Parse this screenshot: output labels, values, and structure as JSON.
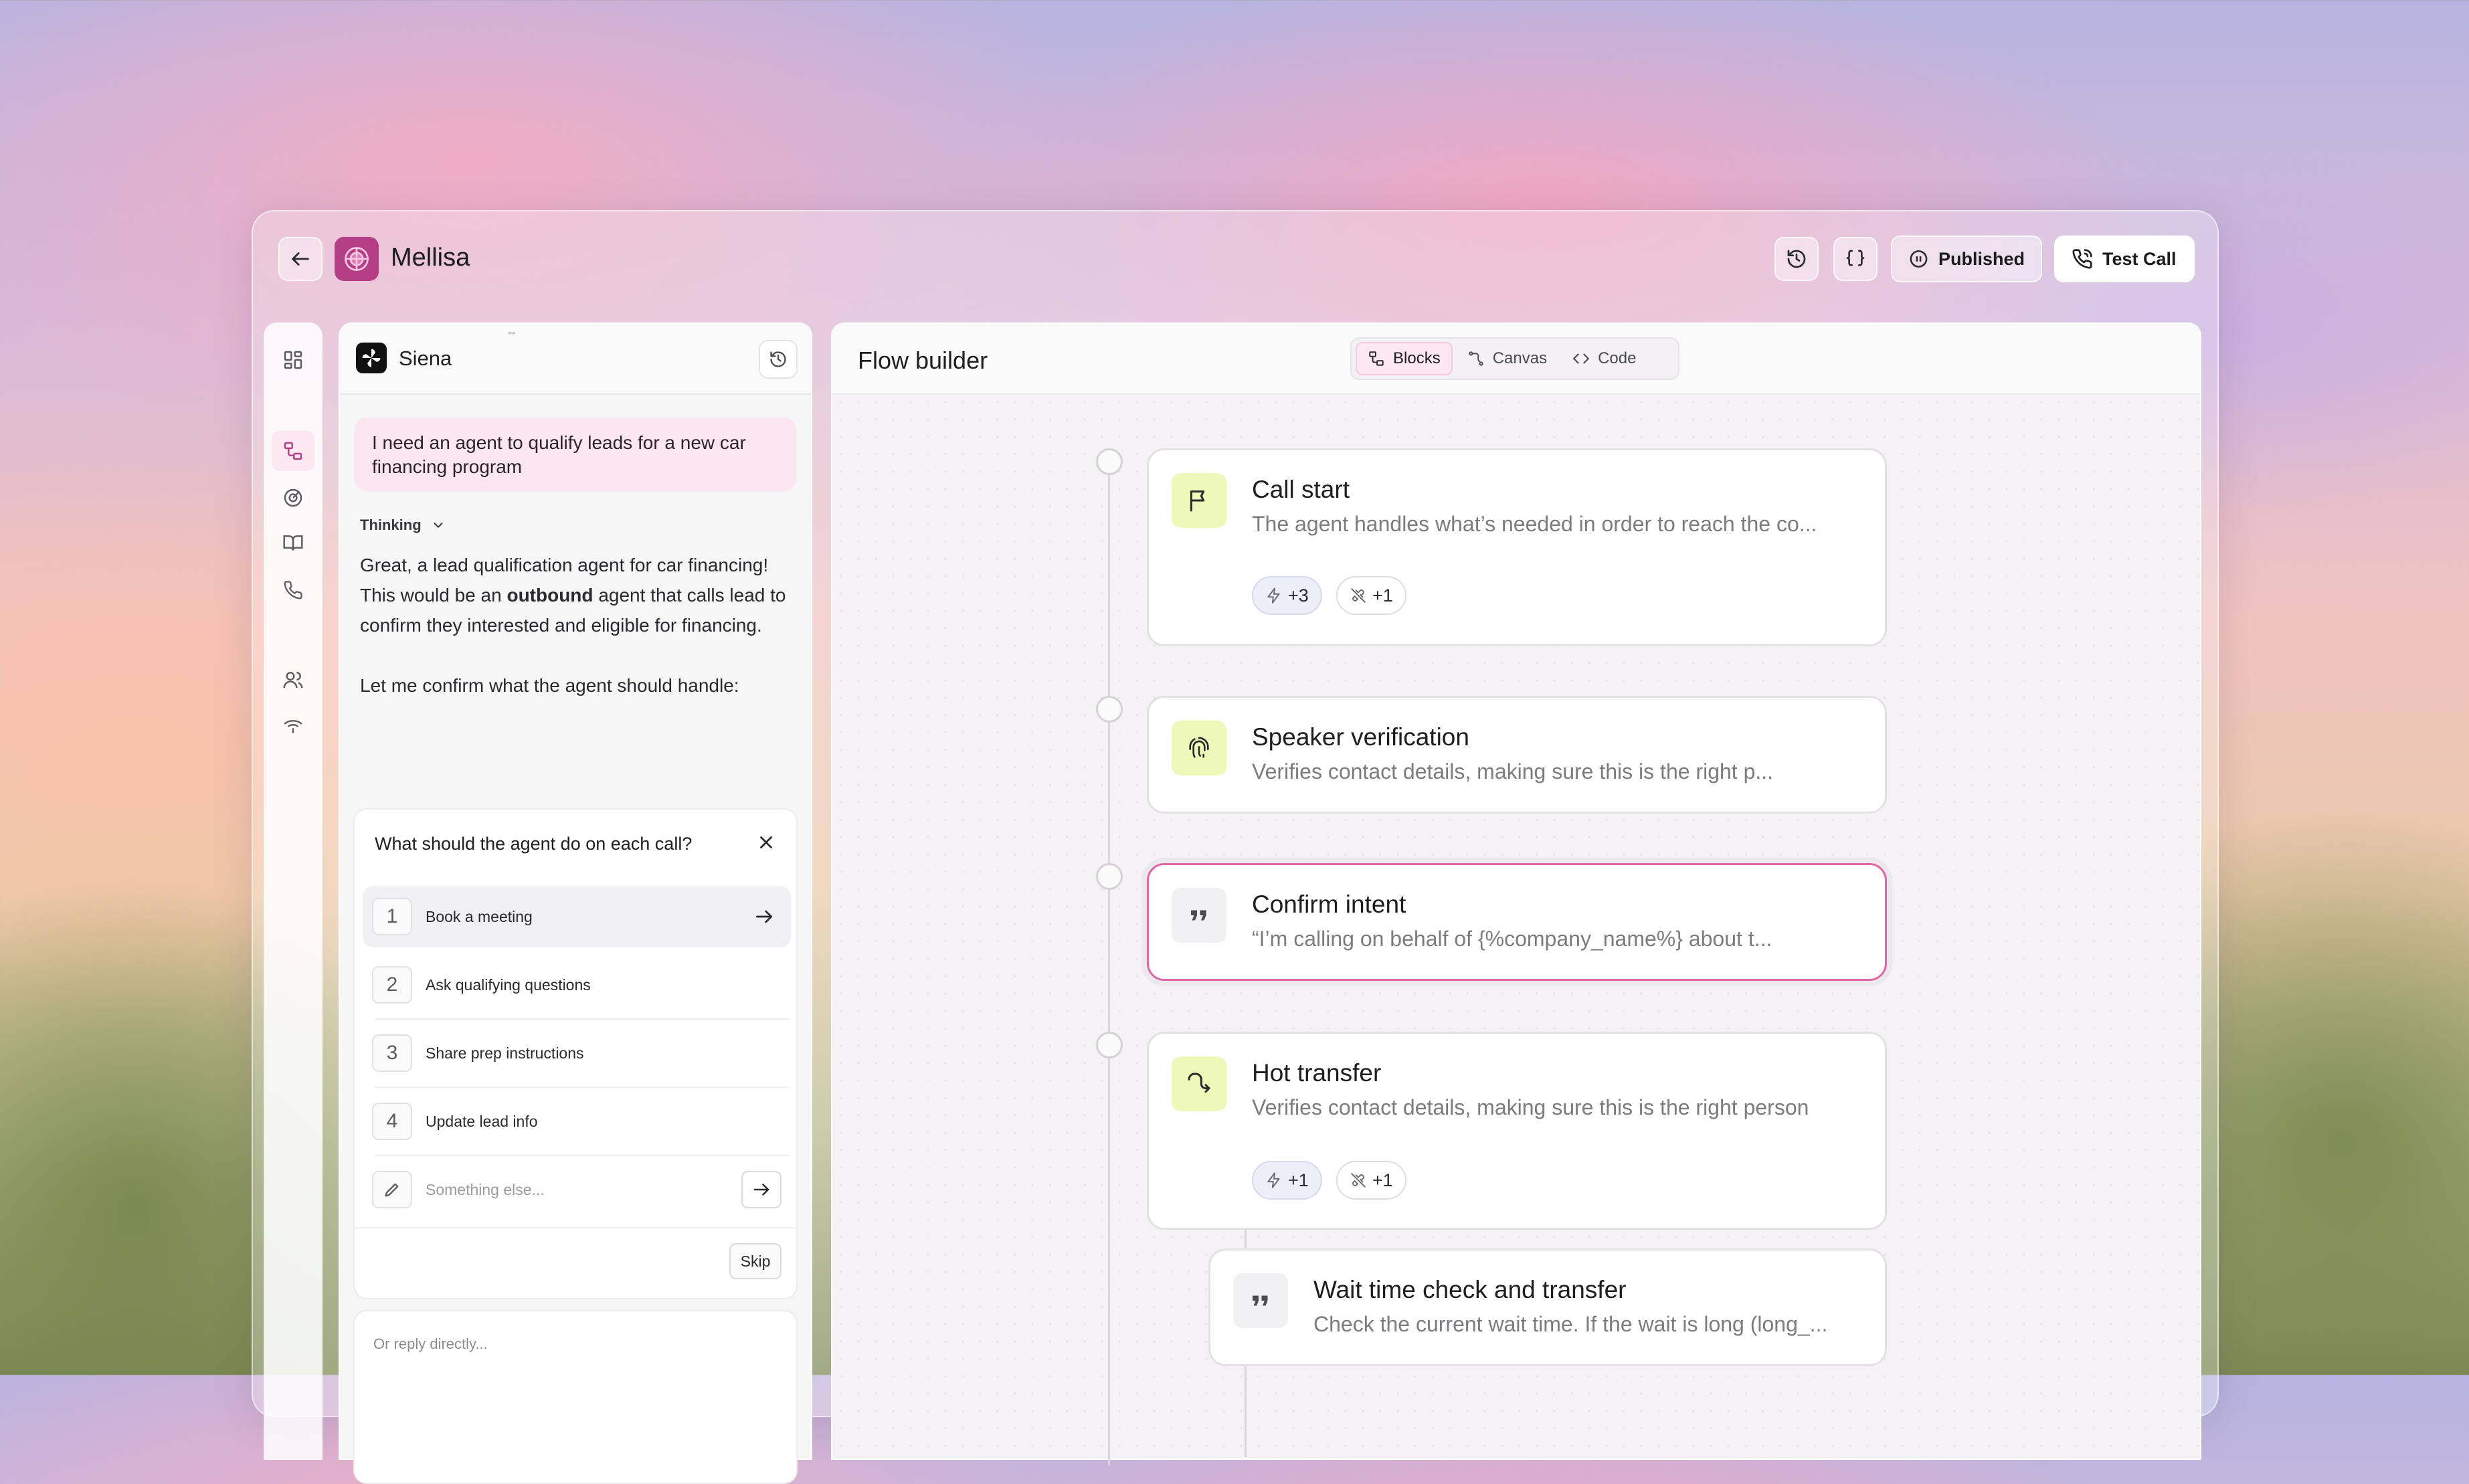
{
  "app": {
    "title": "Mellisa"
  },
  "header": {
    "published_label": "Published",
    "test_call_label": "Test Call"
  },
  "chat": {
    "agent_name": "Siena",
    "user_message": "I need an agent to qualify leads for a new car financing program",
    "thinking_label": "Thinking",
    "assistant_line1": "Great, a lead qualification agent for car financing!",
    "assistant_line2_prefix": "This would be an",
    "assistant_line2_bold": "outbound",
    "assistant_line2_suffix": "agent that calls lead to",
    "assistant_line3": "confirm they interested and eligible for financing.",
    "assistant_line4": "Let me confirm what the agent should handle:",
    "question": {
      "title": "What should the agent do on each call?",
      "options": [
        {
          "num": "1",
          "label": "Book a meeting"
        },
        {
          "num": "2",
          "label": "Ask qualifying questions"
        },
        {
          "num": "3",
          "label": "Share prep instructions"
        },
        {
          "num": "4",
          "label": "Update lead info"
        }
      ],
      "other_placeholder": "Something else...",
      "skip_label": "Skip"
    },
    "reply_placeholder": "Or reply directly..."
  },
  "flow": {
    "title": "Flow builder",
    "tabs": [
      {
        "label": "Blocks",
        "active": true
      },
      {
        "label": "Canvas",
        "active": false
      },
      {
        "label": "Code",
        "active": false
      }
    ],
    "blocks": [
      {
        "title": "Call start",
        "desc": "The agent handles what’s needed in order to reach the co...",
        "chip_actions": "+3",
        "chip_tools": "+1"
      },
      {
        "title": "Speaker verification",
        "desc": "Verifies contact details, making sure this is the right p..."
      },
      {
        "title": "Confirm intent",
        "desc": "“I’m calling on behalf of {%company_name%} about t..."
      },
      {
        "title": "Hot transfer",
        "desc": "Verifies contact details, making sure this is the right person",
        "chip_actions": "+1",
        "chip_tools": "+1"
      },
      {
        "title": "Wait time check and transfer",
        "desc": "Check the current wait time. If the wait is long (long_..."
      }
    ]
  },
  "colors": {
    "accent_pink": "#e066a6",
    "icon_lime": "#eef8b8",
    "bg_panel": "#f4f2f4"
  }
}
